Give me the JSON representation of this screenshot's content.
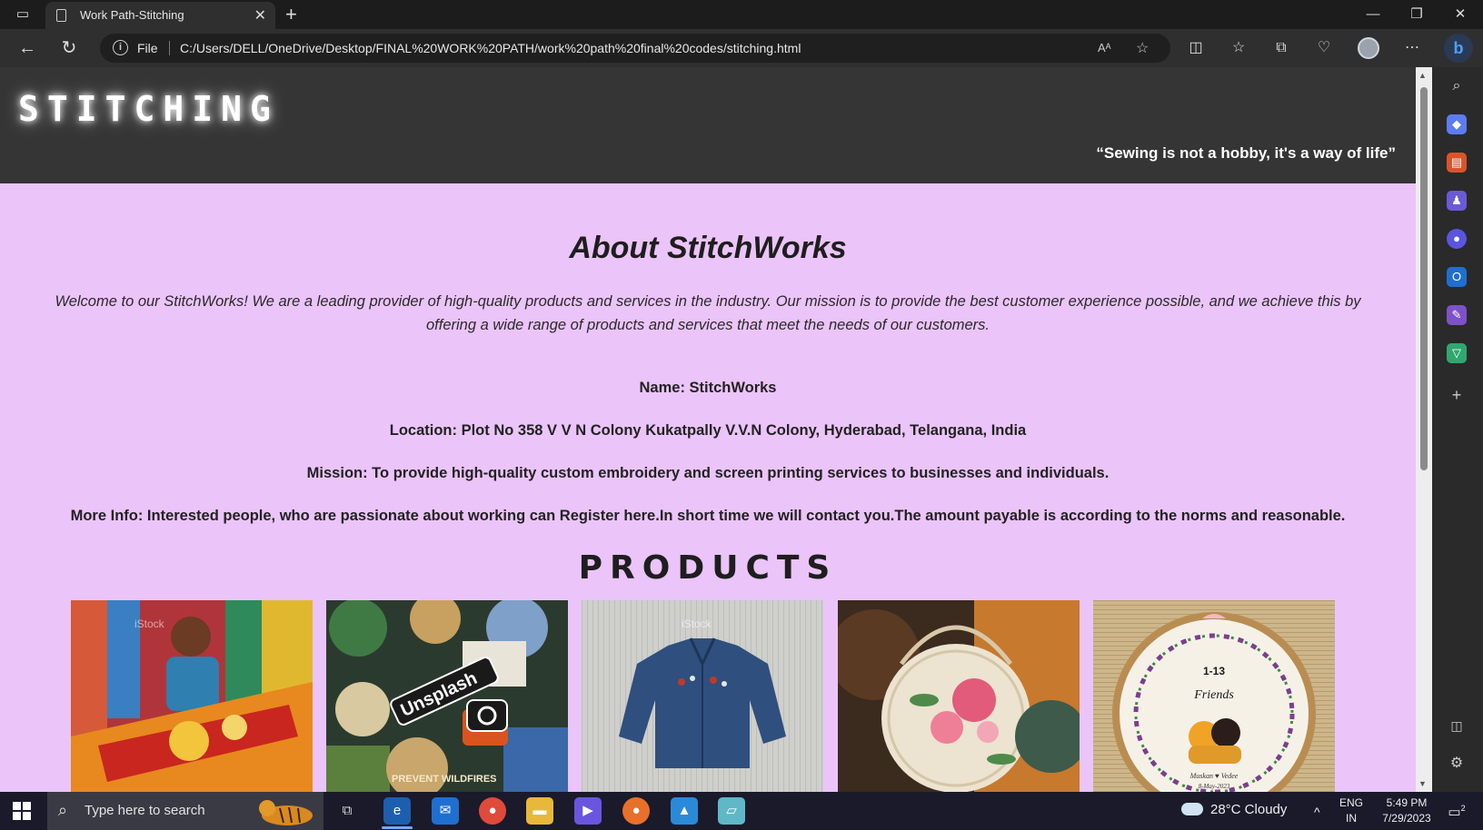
{
  "browser": {
    "tab_title": "Work Path-Stitching",
    "file_label": "File",
    "url": "C:/Users/DELL/OneDrive/Desktop/FINAL%20WORK%20PATH/work%20path%20final%20codes/stitching.html"
  },
  "site": {
    "logo": "STITCHING",
    "tagline": "“Sewing is not a hobby, it's a way of life”"
  },
  "about": {
    "title": "About StitchWorks",
    "text": "Welcome to our StitchWorks! We are a leading provider of high-quality products and services in the industry. Our mission is to provide the best customer experience possible, and we achieve this by offering a wide range of products and services that meet the needs of our customers.",
    "name": "Name: StitchWorks",
    "location": "Location: Plot No 358 V V N Colony Kukatpally V.V.N Colony, Hyderabad, Telangana, India",
    "mission": "Mission: To provide high-quality custom embroidery and screen printing services to businesses and individuals.",
    "more_info": "More Info: Interested people, who are passionate about working can Register here.In short time we will contact you.The amount payable is according to the norms and reasonable."
  },
  "products": {
    "title": "PRODUCTS",
    "items": [
      {
        "name": "woman-with-embroidered-textiles",
        "watermark": "iStock"
      },
      {
        "name": "embroidered-patches",
        "watermark": "Unsplash",
        "patch_text": "PREVENT WILDFIRES"
      },
      {
        "name": "embroidered-denim-jacket",
        "watermark": "iStock"
      },
      {
        "name": "embroidered-rattan-bags",
        "watermark": ""
      },
      {
        "name": "embroidery-hoop-art",
        "watermark": "",
        "hoop_title": "1-13",
        "hoop_subtitle": "Friends",
        "hoop_names": "Muskan ♥ Vedee",
        "hoop_date": "8-May-2023"
      }
    ]
  },
  "taskbar": {
    "search_placeholder": "Type here to search",
    "weather": "28°C  Cloudy",
    "lang_top": "ENG",
    "lang_bottom": "IN",
    "time": "5:49 PM",
    "date": "7/29/2023",
    "notification_count": "2"
  },
  "colors": {
    "page_bg": "#ebc4f9",
    "header_bg": "#353535"
  }
}
